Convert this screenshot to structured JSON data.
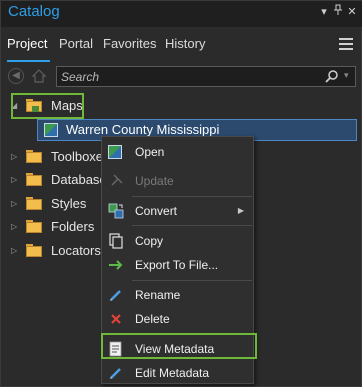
{
  "window": {
    "title": "Catalog"
  },
  "tabs": [
    {
      "label": "Project",
      "active": true
    },
    {
      "label": "Portal",
      "active": false
    },
    {
      "label": "Favorites",
      "active": false
    },
    {
      "label": "History",
      "active": false
    }
  ],
  "search": {
    "placeholder": "Search",
    "value": ""
  },
  "tree": {
    "maps_label": "Maps",
    "selected_map": "Warren County Mississippi",
    "items": [
      {
        "label": "Toolboxes"
      },
      {
        "label": "Databases"
      },
      {
        "label": "Styles"
      },
      {
        "label": "Folders"
      },
      {
        "label": "Locators"
      }
    ]
  },
  "context_menu": {
    "items": [
      {
        "label": "Open",
        "icon": "map-icon",
        "enabled": true
      },
      {
        "label": "Update",
        "icon": "update-icon",
        "enabled": false
      },
      {
        "label": "Convert",
        "icon": "convert-icon",
        "enabled": true,
        "submenu": true
      },
      {
        "label": "Copy",
        "icon": "copy-icon",
        "enabled": true
      },
      {
        "label": "Export To File...",
        "icon": "export-arrow-icon",
        "enabled": true
      },
      {
        "label": "Rename",
        "icon": "pencil-icon",
        "enabled": true
      },
      {
        "label": "Delete",
        "icon": "delete-x-icon",
        "enabled": true
      },
      {
        "label": "View Metadata",
        "icon": "metadata-icon",
        "enabled": true,
        "highlighted": true
      },
      {
        "label": "Edit Metadata",
        "icon": "pencil-icon",
        "enabled": true
      }
    ]
  },
  "colors": {
    "accent": "#2e9ee8",
    "highlight_outline": "#6fb83a",
    "selection": "#2b4a6e"
  }
}
